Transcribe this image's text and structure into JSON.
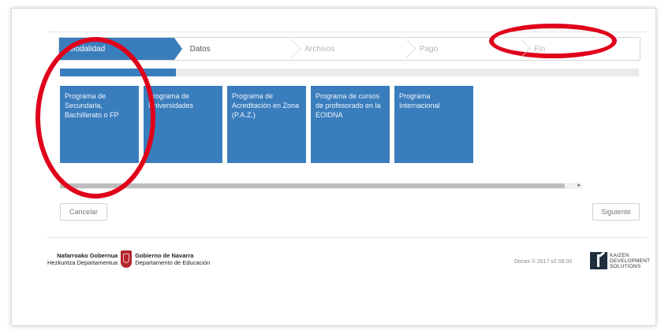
{
  "header": {
    "logo_text": "",
    "logo_accent": ""
  },
  "stepper": {
    "steps": [
      {
        "label": "Modalidad",
        "state": "active"
      },
      {
        "label": "Datos",
        "state": "next"
      },
      {
        "label": "Archivos",
        "state": "pending"
      },
      {
        "label": "Pago",
        "state": "pending"
      },
      {
        "label": "Fin",
        "state": "pending"
      }
    ],
    "progress_fraction": 0.2
  },
  "programs": [
    {
      "label": "Programa de Secundaria, Bachillerato o FP"
    },
    {
      "label": "Programa de Universidades"
    },
    {
      "label": "Programa de Acreditación en Zona (P.A.Z.)"
    },
    {
      "label": "Programa de cursos de profesorado en la EOIDNA"
    },
    {
      "label": "Programa Internacional"
    }
  ],
  "actions": {
    "cancel_label": "Cancelar",
    "next_label": "Siguiente"
  },
  "footer": {
    "gov_left_line1": "Nafarroako Gobernua",
    "gov_left_line2": "Hezkuntza Departamentua",
    "gov_right_line1": "Gobierno de Navarra",
    "gov_right_line2": "Departamento de Educación",
    "version": "Docex © 2017 v2.08.00",
    "vendor_line1": "KAIZEN",
    "vendor_line2": "DEVELOPMENT",
    "vendor_line3": "SOLUTIONS"
  },
  "colors": {
    "primary": "#3a7dbd",
    "annotation": "#e0001a",
    "brand_red": "#b5262d"
  }
}
